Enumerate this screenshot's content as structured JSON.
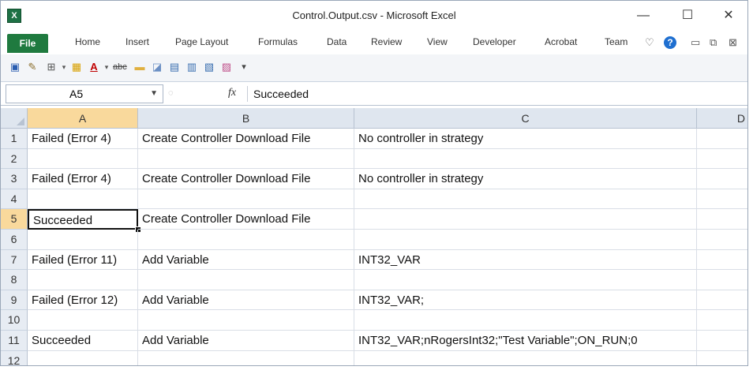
{
  "window": {
    "title": "Control.Output.csv  -  Microsoft Excel",
    "minimize": "—",
    "maximize": "☐",
    "close": "✕"
  },
  "ribbon": {
    "file": "File",
    "tabs": [
      "Home",
      "Insert",
      "Page Layout",
      "Formulas",
      "Data",
      "Review",
      "View",
      "Developer",
      "Acrobat",
      "Team"
    ],
    "help": "?"
  },
  "formula_bar": {
    "name_box": "A5",
    "fx": "fx",
    "value": "Succeeded"
  },
  "sheet": {
    "columns": [
      "A",
      "B",
      "C",
      "D"
    ],
    "selected_column": "A",
    "selected_row": "5",
    "rows": [
      {
        "num": "1",
        "cells": [
          "Failed (Error 4)",
          "Create Controller Download File",
          "No controller in strategy"
        ]
      },
      {
        "num": "2",
        "cells": [
          "",
          "",
          ""
        ]
      },
      {
        "num": "3",
        "cells": [
          "Failed (Error 4)",
          "Create Controller Download File",
          "No controller in strategy"
        ]
      },
      {
        "num": "4",
        "cells": [
          "",
          "",
          ""
        ]
      },
      {
        "num": "5",
        "cells": [
          "Succeeded",
          "Create Controller Download File",
          ""
        ]
      },
      {
        "num": "6",
        "cells": [
          "",
          "",
          ""
        ]
      },
      {
        "num": "7",
        "cells": [
          "Failed (Error 11)",
          "Add Variable",
          "INT32_VAR"
        ]
      },
      {
        "num": "8",
        "cells": [
          "",
          "",
          ""
        ]
      },
      {
        "num": "9",
        "cells": [
          "Failed (Error 12)",
          "Add Variable",
          "INT32_VAR;"
        ]
      },
      {
        "num": "10",
        "cells": [
          "",
          "",
          ""
        ]
      },
      {
        "num": "11",
        "cells": [
          "Succeeded",
          "Add Variable",
          "INT32_VAR;nRogersInt32;\"Test Variable\";ON_RUN;0"
        ]
      },
      {
        "num": "12",
        "cells": [
          "",
          "",
          ""
        ]
      }
    ]
  }
}
